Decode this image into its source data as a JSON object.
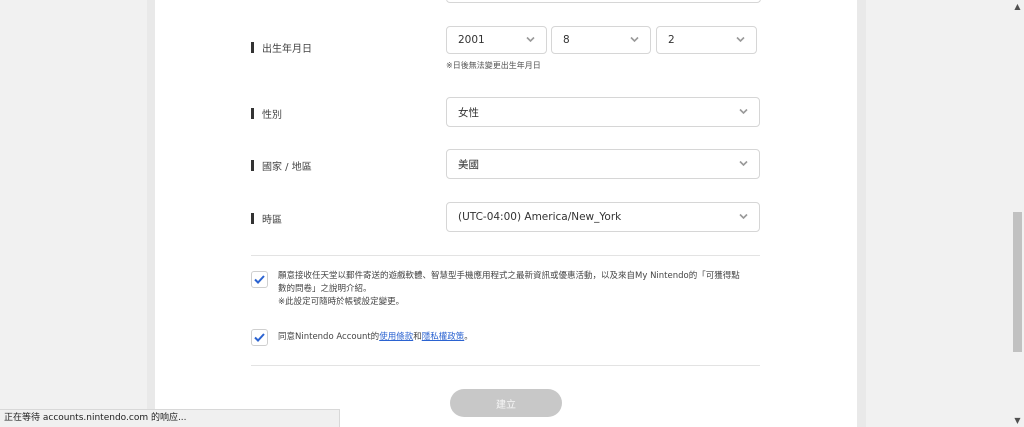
{
  "form": {
    "birthdate": {
      "label": "出生年月日",
      "year": "2001",
      "month": "8",
      "day": "2",
      "note": "※日後無法變更出生年月日"
    },
    "gender": {
      "label": "性別",
      "value": "女性"
    },
    "country": {
      "label": "國家 / 地區",
      "value": "美國"
    },
    "timezone": {
      "label": "時區",
      "value": "(UTC-04:00) America/New_York"
    },
    "consent_marketing": {
      "checked": true,
      "line1": "願意接收任天堂以郵件寄送的遊戲軟體、智慧型手機應用程式之最新資訊或優惠活動，以及來自My Nintendo的「可獲得點",
      "line2": "數的問卷」之說明介紹。",
      "line3": "※此設定可隨時於帳號設定變更。"
    },
    "consent_terms": {
      "checked": true,
      "prefix": "同意Nintendo Account的",
      "terms_link": "使用條款",
      "and": "和",
      "privacy_link": "隱私權政策",
      "suffix": "。"
    },
    "submit_label": "建立"
  },
  "status_bar": {
    "text": "正在等待 accounts.nintendo.com 的响应..."
  },
  "colors": {
    "checkmark": "#2b63d1",
    "link": "#2b63d1",
    "button_disabled": "#c8c8c8"
  }
}
